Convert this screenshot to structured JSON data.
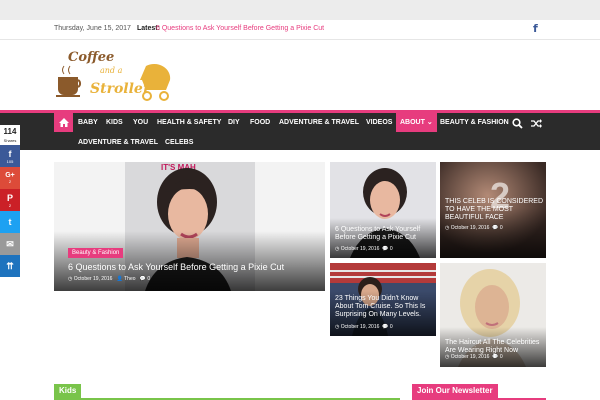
{
  "topbar": {
    "date": "Thursday, June 15, 2017",
    "latest_label": "Latest:",
    "latest_link": "6 Questions to Ask Yourself Before Getting a Pixie Cut",
    "facebook_icon": "f"
  },
  "logo": {
    "line1": "Coffee",
    "line2": "and a",
    "line3": "Stroller"
  },
  "nav": {
    "items_row1": [
      "BABY",
      "KIDS",
      "YOU",
      "HEALTH & SAFETY",
      "DIY",
      "FOOD",
      "ADVENTURE & TRAVEL",
      "VIDEOS"
    ],
    "active": "ABOUT",
    "active_arrow": "⌄",
    "beauty": "BEAUTY & FASHION",
    "items_row2": [
      "ADVENTURE & TRAVEL",
      "CELEBS"
    ]
  },
  "share": {
    "count": "114",
    "count_label": "Shares",
    "facebook": {
      "glyph": "f",
      "count": "105"
    },
    "google": {
      "glyph": "G+",
      "count": "2"
    },
    "pinterest": {
      "glyph": "P",
      "count": "2"
    },
    "twitter": {
      "glyph": "t"
    },
    "email": {
      "glyph": "✉"
    },
    "more": {
      "glyph": "⇈"
    }
  },
  "featured": {
    "badge": "Beauty & Fashion",
    "title": "6 Questions to Ask Yourself Before Getting a Pixie Cut",
    "date": "October 19, 2016",
    "author": "Theo",
    "comments": "0",
    "backdrop_text": "IT'S MAH"
  },
  "side_posts": [
    {
      "title": "6 Questions to Ask Yourself Before Getting a Pixie Cut",
      "date": "October 19, 2016",
      "comments": "0"
    },
    {
      "title": "THIS CELEB IS CONSIDERED TO HAVE THE MOST BEAUTIFUL FACE",
      "date": "October 19, 2016",
      "comments": "0"
    },
    {
      "title": "23 Things You Didn't Know About Tom Cruise. So This Is Surprising On Many Levels.",
      "date": "October 19, 2016",
      "comments": "0"
    },
    {
      "title": "The Haircut All The Celebrities Are Wearing Right Now",
      "date": "October 19, 2016",
      "comments": "0"
    }
  ],
  "sections": {
    "kids": "Kids",
    "newsletter": "Join Our Newsletter"
  },
  "colors": {
    "accent": "#e73c7e",
    "nav_bg": "#2b2b2b",
    "kids_green": "#79c44a"
  }
}
